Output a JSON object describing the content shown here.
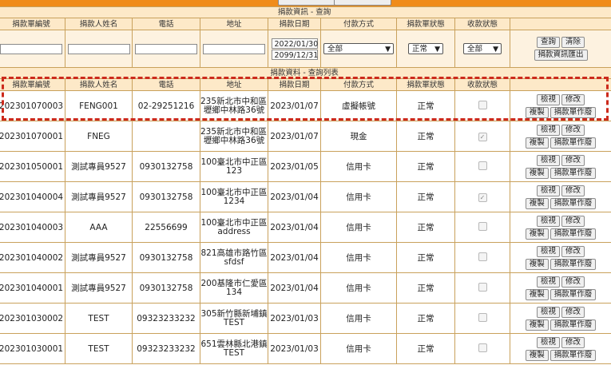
{
  "top": {
    "label": "",
    "buttons": [
      "",
      ""
    ]
  },
  "query_title": "捐款資訊 - 查詢",
  "list_title": "捐款資料 - 查詢列表",
  "headers": [
    "捐款單編號",
    "捐款人姓名",
    "電話",
    "地址",
    "捐款日期",
    "付款方式",
    "捐款單狀態",
    "收款狀態",
    ""
  ],
  "filter": {
    "donation_no": "",
    "donor_name": "",
    "phone": "",
    "address": "",
    "date_from": "2022/01/30",
    "date_to": "2099/12/31",
    "payment": "全部",
    "status": "正常",
    "received": "全部",
    "query_button": "查詢",
    "clear_button": "清除",
    "export_button": "捐款資訊匯出"
  },
  "row_buttons": {
    "view": "檢視",
    "edit": "修改",
    "copy": "複製",
    "voucher": "捐款單作廢"
  },
  "rows": [
    {
      "no": "202301070003",
      "name": "FENG001",
      "phone": "02-29251216",
      "addr1": "235新北市中和區內",
      "addr2": "壢鄉中林路36號",
      "date": "2023/01/07",
      "pay": "虛擬帳號",
      "status": "正常",
      "received": false
    },
    {
      "no": "202301070001",
      "name": "FNEG",
      "phone": "",
      "addr1": "235新北市中和區內",
      "addr2": "壢鄉中林路36號",
      "date": "2023/01/07",
      "pay": "現金",
      "status": "正常",
      "received": true
    },
    {
      "no": "202301050001",
      "name": "測試專員9527",
      "phone": "0930132758",
      "addr1": "100臺北市中正區",
      "addr2": "123",
      "date": "2023/01/05",
      "pay": "信用卡",
      "status": "正常",
      "received": false
    },
    {
      "no": "202301040004",
      "name": "測試專員9527",
      "phone": "0930132758",
      "addr1": "100臺北市中正區",
      "addr2": "1234",
      "date": "2023/01/04",
      "pay": "信用卡",
      "status": "正常",
      "received": true
    },
    {
      "no": "202301040003",
      "name": "AAA",
      "phone": "22556699",
      "addr1": "100臺北市中正區",
      "addr2": "address",
      "date": "2023/01/04",
      "pay": "信用卡",
      "status": "正常",
      "received": false
    },
    {
      "no": "202301040002",
      "name": "測試專員9527",
      "phone": "0930132758",
      "addr1": "821高雄市路竹區",
      "addr2": "sfdsf",
      "date": "2023/01/04",
      "pay": "信用卡",
      "status": "正常",
      "received": false
    },
    {
      "no": "202301040001",
      "name": "測試專員9527",
      "phone": "0930132758",
      "addr1": "200基隆市仁愛區",
      "addr2": "134",
      "date": "2023/01/04",
      "pay": "信用卡",
      "status": "正常",
      "received": false
    },
    {
      "no": "202301030002",
      "name": "TEST",
      "phone": "09323233232",
      "addr1": "305新竹縣新埔鎮",
      "addr2": "TEST",
      "date": "2023/01/03",
      "pay": "信用卡",
      "status": "正常",
      "received": false
    },
    {
      "no": "202301030001",
      "name": "TEST",
      "phone": "09323233232",
      "addr1": "651雲林縣北港鎮",
      "addr2": "TEST",
      "date": "2023/01/03",
      "pay": "信用卡",
      "status": "正常",
      "received": false
    }
  ],
  "colors": {
    "header_bg": "#fde9c8",
    "border": "#c9a15c",
    "top_bar": "#f08c1a",
    "highlight": "#cc2a1c"
  }
}
